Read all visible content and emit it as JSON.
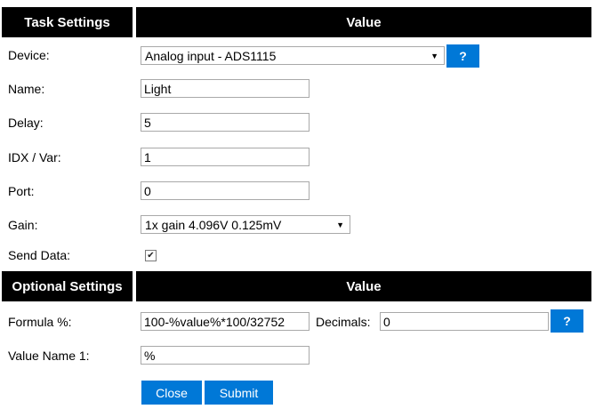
{
  "task_settings": {
    "header_left": "Task Settings",
    "header_right": "Value",
    "device_label": "Device:",
    "device_value": "Analog input - ADS1115",
    "help_label": "?",
    "name_label": "Name:",
    "name_value": "Light",
    "delay_label": "Delay:",
    "delay_value": "5",
    "idx_label": "IDX / Var:",
    "idx_value": "1",
    "port_label": "Port:",
    "port_value": "0",
    "gain_label": "Gain:",
    "gain_value": "1x gain 4.096V 0.125mV",
    "send_label": "Send Data:",
    "send_checked": true
  },
  "optional_settings": {
    "header_left": "Optional Settings",
    "header_right": "Value",
    "formula_label": "Formula %:",
    "formula_value": "100-%value%*100/32752",
    "decimals_label": "Decimals:",
    "decimals_value": "0",
    "help_label": "?",
    "value_name_label": "Value Name 1:",
    "value_name_value": "%"
  },
  "buttons": {
    "close": "Close",
    "submit": "Submit"
  },
  "colors": {
    "header_bg": "#000000",
    "button_bg": "#0078d7"
  }
}
